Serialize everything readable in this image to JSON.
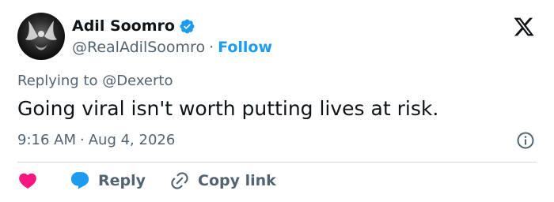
{
  "author": {
    "display_name": "Adil Soomro",
    "handle": "@RealAdilSoomro",
    "separator": "·",
    "follow_label": "Follow",
    "verified_icon": "verified-badge-icon",
    "avatar": "avatar"
  },
  "tweet": {
    "replying_to": "Replying to @Dexerto",
    "text": "Going viral isn't worth putting lives at risk.",
    "time": "9:16 AM",
    "separator": "·",
    "date": "Aug 4, 2026"
  },
  "actions": {
    "like_icon": "heart-icon",
    "reply_label": "Reply",
    "reply_icon": "reply-bubble-icon",
    "copy_label": "Copy link",
    "copy_icon": "link-icon"
  },
  "icons": {
    "logo": "x-logo-icon",
    "info": "info-icon"
  },
  "colors": {
    "accent": "#1d9bf0",
    "heart": "#f91880",
    "text": "#0f1419",
    "muted": "#536471",
    "divider": "#cfd9de"
  }
}
